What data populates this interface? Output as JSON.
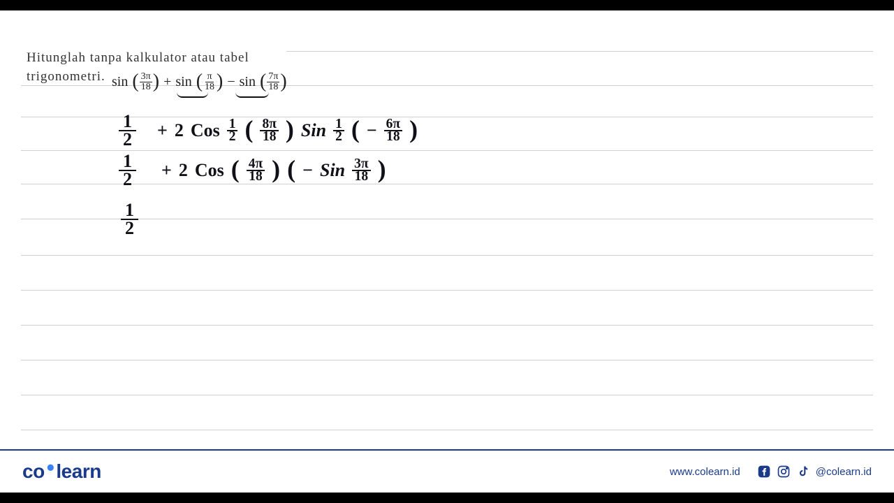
{
  "problem": {
    "line1": "Hitunglah tanpa kalkulator atau tabel",
    "line2": "trigonometri."
  },
  "formula": {
    "fn": "sin",
    "t1_num": "3π",
    "t1_den": "18",
    "plus": "+",
    "t2_num": "π",
    "t2_den": "18",
    "minus": "−",
    "t3_num": "7π",
    "t3_den": "18"
  },
  "hand": {
    "row1_half_num": "1",
    "row1_half_den": "2",
    "row1_plus": "+",
    "row1_two": "2",
    "row1_cos": "Cos",
    "row1_half2_num": "1",
    "row1_half2_den": "2",
    "row1_a_num": "8π",
    "row1_a_den": "18",
    "row1_sin": "Sin",
    "row1_half3_num": "1",
    "row1_half3_den": "2",
    "row1_neg": "−",
    "row1_b_num": "6π",
    "row1_b_den": "18",
    "row2_half_num": "1",
    "row2_half_den": "2",
    "row2_plus": "+",
    "row2_two": "2",
    "row2_cos": "Cos",
    "row2_a_num": "4π",
    "row2_a_den": "18",
    "row2_neg": "−",
    "row2_sin": "Sin",
    "row2_b_num": "3π",
    "row2_b_den": "18",
    "row3_half_num": "1",
    "row3_half_den": "2"
  },
  "footer": {
    "logo_co": "co",
    "logo_dot": "•",
    "logo_learn": "learn",
    "url": "www.colearn.id",
    "handle": "@colearn.id"
  }
}
